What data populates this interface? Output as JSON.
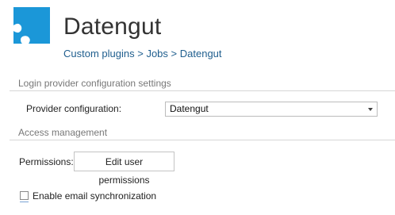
{
  "header": {
    "title": "Datengut",
    "icon": "puzzle-piece-icon",
    "icon_color": "#1b97d8"
  },
  "breadcrumb": {
    "items": [
      "Custom plugins",
      "Jobs",
      "Datengut"
    ],
    "separator": ">",
    "link_color": "#1f5e8e"
  },
  "login_section": {
    "heading": "Login provider configuration settings",
    "provider_label": "Provider configuration:",
    "provider_value": "Datengut"
  },
  "access_section": {
    "heading": "Access management",
    "permissions_label": "Permissions:",
    "edit_button_label": "Edit user permissions",
    "email_sync_label": "Enable email synchronization",
    "email_sync_checked": false
  }
}
